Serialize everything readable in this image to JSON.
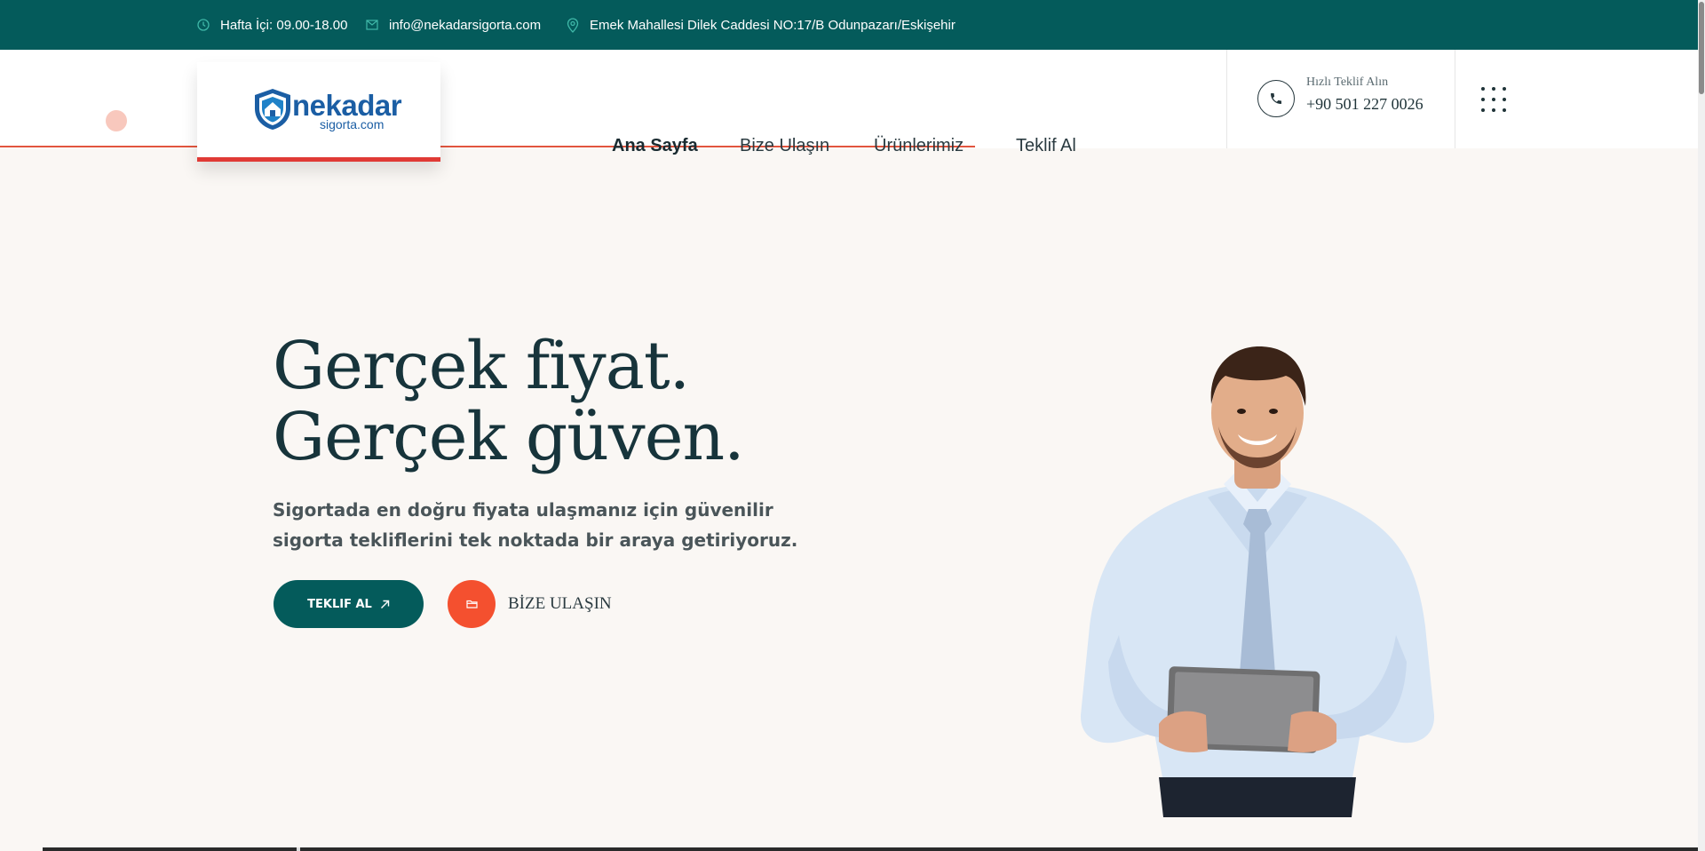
{
  "topbar": {
    "hours": "Hafta İçi: 09.00-18.00",
    "email": "info@nekadarsigorta.com",
    "address": "Emek Mahallesi Dilek Caddesi NO:17/B Odunpazarı/Eskişehir"
  },
  "logo": {
    "word": "nekadar",
    "sub": "sigorta.com"
  },
  "nav": {
    "items": [
      "Ana Sayfa",
      "Bize Ulaşın",
      "Ürünlerimiz",
      "Teklif Al"
    ],
    "active_index": 0
  },
  "contact": {
    "label": "Hızlı Teklif Alın",
    "phone": "+90 501 227 0026"
  },
  "hero": {
    "title_line1": "Gerçek fiyat.",
    "title_line2": "Gerçek güven.",
    "description": "Sigortada en doğru fiyata ulaşmanız için güvenilir sigorta tekliflerini tek noktada bir araya getiriyoruz.",
    "primary_button": "TEKLIF AL",
    "secondary_link": "BİZE ULAŞIN"
  },
  "colors": {
    "topbar": "#045b5b",
    "accent_orange": "#f4502f",
    "accent_red": "#e03a35",
    "logo_blue": "#1b5ea4",
    "background": "#faf7f4"
  },
  "icons": {
    "hours": "clock-icon",
    "email": "envelope-icon",
    "address": "map-pin-icon",
    "phone": "phone-icon",
    "menu": "grid-menu-icon",
    "primary_button": "arrow-up-right-icon",
    "secondary_button": "folder-icon"
  }
}
